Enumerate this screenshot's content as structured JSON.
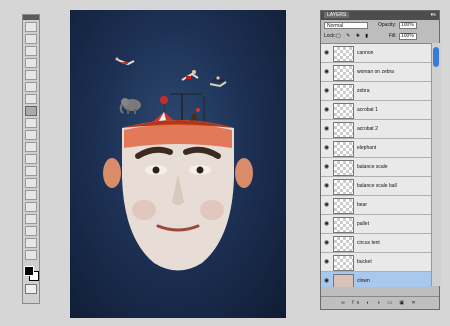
{
  "tools": {
    "items": [
      "move",
      "marquee",
      "lasso",
      "quick-select",
      "crop",
      "eyedropper",
      "healing",
      "brush",
      "clone",
      "history",
      "eraser",
      "gradient",
      "blur",
      "dodge",
      "pen",
      "type",
      "path-select",
      "shape",
      "hand",
      "zoom"
    ],
    "selected_index": 7,
    "foreground_color": "#000000",
    "background_color": "#ffffff"
  },
  "layers_panel": {
    "tab_label": "LAYERS",
    "menu_glyph": "▾≡",
    "blend_mode": "Normal",
    "opacity_label": "Opacity:",
    "opacity_value": "100%",
    "lock_label": "Lock:",
    "lock_icons": "▢ ✎ ✚ ▮",
    "fill_label": "Fill:",
    "fill_value": "100%",
    "layers": [
      {
        "name": "cannon",
        "selected": false
      },
      {
        "name": "woman on zebra",
        "selected": false
      },
      {
        "name": "zebra",
        "selected": false
      },
      {
        "name": "acrobat 1",
        "selected": false
      },
      {
        "name": "acrobat 2",
        "selected": false
      },
      {
        "name": "elephant",
        "selected": false
      },
      {
        "name": "balance scale",
        "selected": false
      },
      {
        "name": "balance scale ball",
        "selected": false
      },
      {
        "name": "bear",
        "selected": false
      },
      {
        "name": "pallet",
        "selected": false
      },
      {
        "name": "circus tent",
        "selected": false
      },
      {
        "name": "bucket",
        "selected": false
      },
      {
        "name": "clown",
        "selected": true
      }
    ],
    "footer_icons": "∞ fx ◐ ◑ ▭ ▣ ✕"
  },
  "colors": {
    "canvas_bg": "#1d3155",
    "selection": "#a9c8ee",
    "scroll_thumb": "#3a7bd5"
  }
}
